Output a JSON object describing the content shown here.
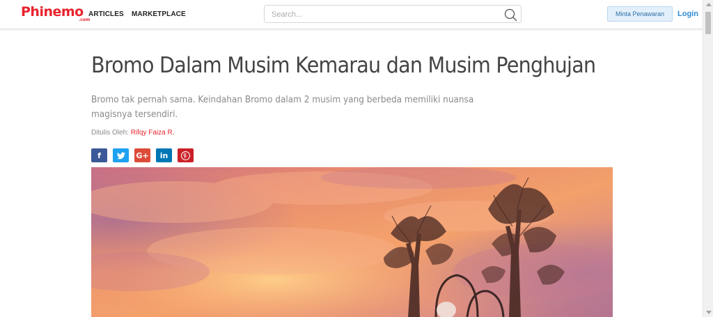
{
  "header": {
    "logo": {
      "text": "Phinemo",
      "suffix": ".com"
    },
    "nav": {
      "articles": "ARTICLES",
      "marketplace": "MARKETPLACE"
    },
    "search": {
      "placeholder": "Search...",
      "value": ""
    },
    "offer_button": "Minta Penawaran",
    "login": "Login"
  },
  "article": {
    "title": "Bromo Dalam Musim Kemarau dan Musim Penghujan",
    "lead": "Bromo tak pernah sama. Keindahan Bromo dalam 2 musim yang berbeda memiliki nuansa magisnya tersendiri.",
    "byline_label": "Ditulis Oleh:",
    "author": "Rifqy Faiza R."
  },
  "share": {
    "facebook": "f",
    "twitter": "t",
    "googleplus": "G+",
    "linkedin": "in",
    "pinterest": "p"
  },
  "icons": [
    "search-icon",
    "facebook-icon",
    "twitter-icon",
    "google-plus-icon",
    "linkedin-icon",
    "pinterest-icon"
  ],
  "colors": {
    "brand": "#e8232d",
    "link": "#2e8bd8",
    "facebook": "#3b5998",
    "twitter": "#1da1f2",
    "googleplus": "#dd4b39",
    "linkedin": "#0077b5",
    "pinterest": "#cb2027"
  }
}
